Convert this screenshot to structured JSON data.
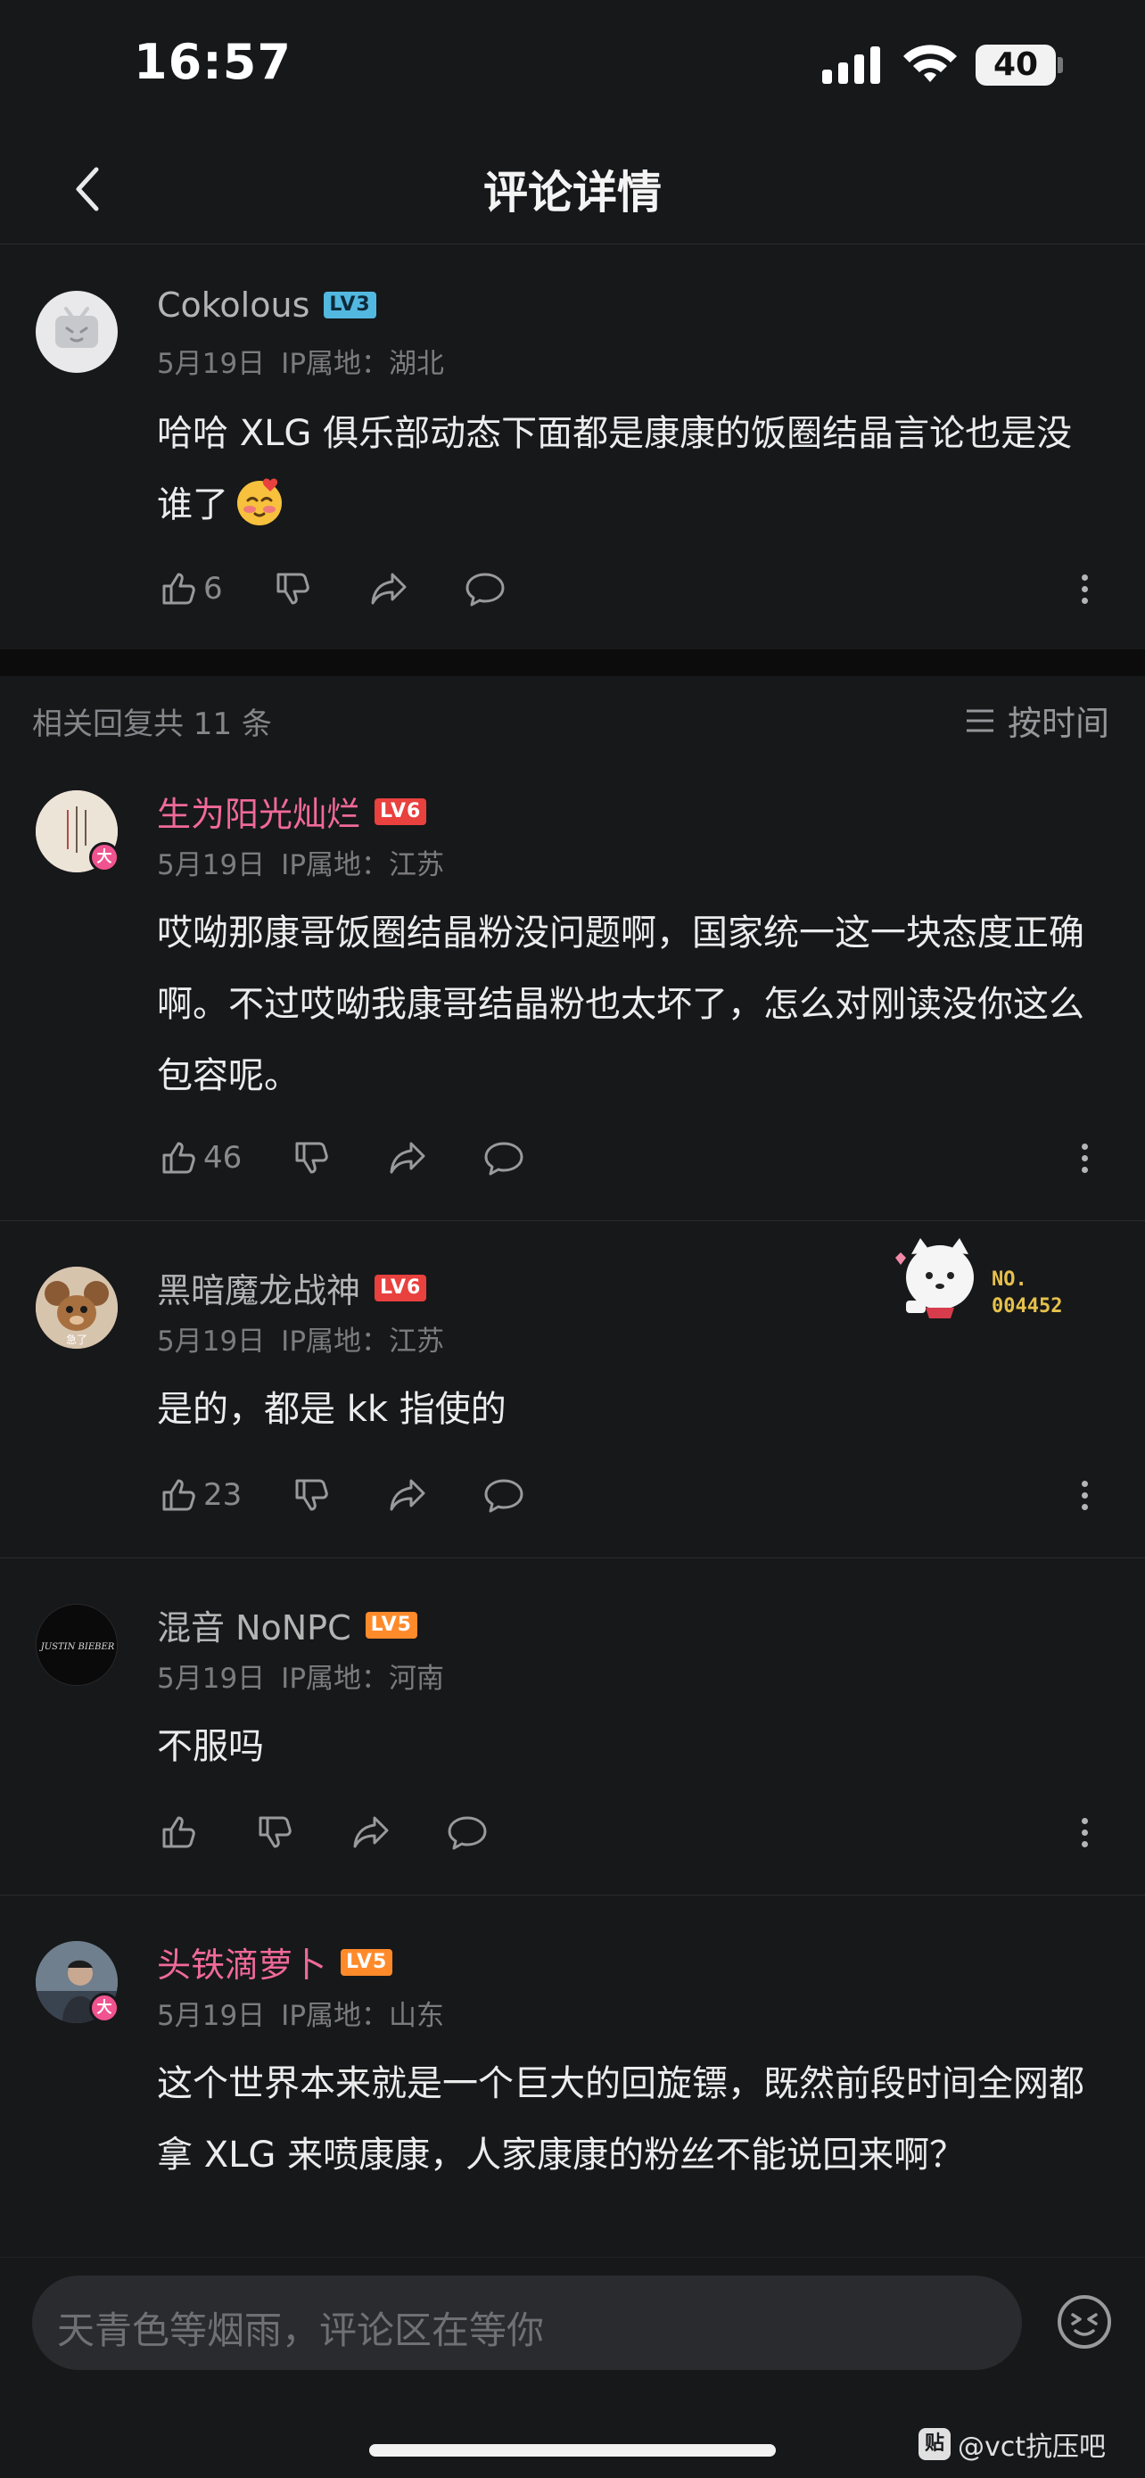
{
  "status": {
    "time": "16:57",
    "battery": "40"
  },
  "nav": {
    "title": "评论详情"
  },
  "main_comment": {
    "username": "Cokolous",
    "level": "LV3",
    "date": "5月19日",
    "location": "IP属地：湖北",
    "text": "哈哈 XLG 俱乐部动态下面都是康康的饭圈结晶言论也是没谁了",
    "likes": "6"
  },
  "replies_header": {
    "count_text": "相关回复共 11 条",
    "sort_label": "按时间"
  },
  "replies": [
    {
      "username": "生为阳光灿烂",
      "level": "LV6",
      "badge": "大",
      "date": "5月19日",
      "location": "IP属地：江苏",
      "text": "哎呦那康哥饭圈结晶粉没问题啊，国家统一这一块态度正确啊。不过哎呦我康哥结晶粉也太坏了，怎么对刚读没你这么包容呢。",
      "likes": "46"
    },
    {
      "username": "黑暗魔龙战神",
      "level": "LV6",
      "date": "5月19日",
      "location": "IP属地：江苏",
      "text": "是的，都是 kk 指使的",
      "likes": "23",
      "sticker_no": "NO.",
      "sticker_num": "004452",
      "avatar_caption": "急了"
    },
    {
      "username": "混音 NoNPC",
      "level": "LV5",
      "date": "5月19日",
      "location": "IP属地：河南",
      "text": "不服吗",
      "likes": "",
      "avatar_caption": "JUSTIN BIEBER"
    },
    {
      "username": "头铁滴萝卜",
      "level": "LV5",
      "badge": "大",
      "date": "5月19日",
      "location": "IP属地：山东",
      "text": "这个世界本来就是一个巨大的回旋镖，既然前段时间全网都拿 XLG 来喷康康，人家康康的粉丝不能说回来啊？"
    }
  ],
  "input": {
    "placeholder": "天青色等烟雨，评论区在等你"
  },
  "watermark": {
    "logo": "贴",
    "text": "@vct抗压吧"
  },
  "colors": {
    "background": "#17181a",
    "pink_name": "#f0699a",
    "lv6": "#e8413e",
    "lv5": "#ff8a2a",
    "lv3": "#52b8e0"
  }
}
